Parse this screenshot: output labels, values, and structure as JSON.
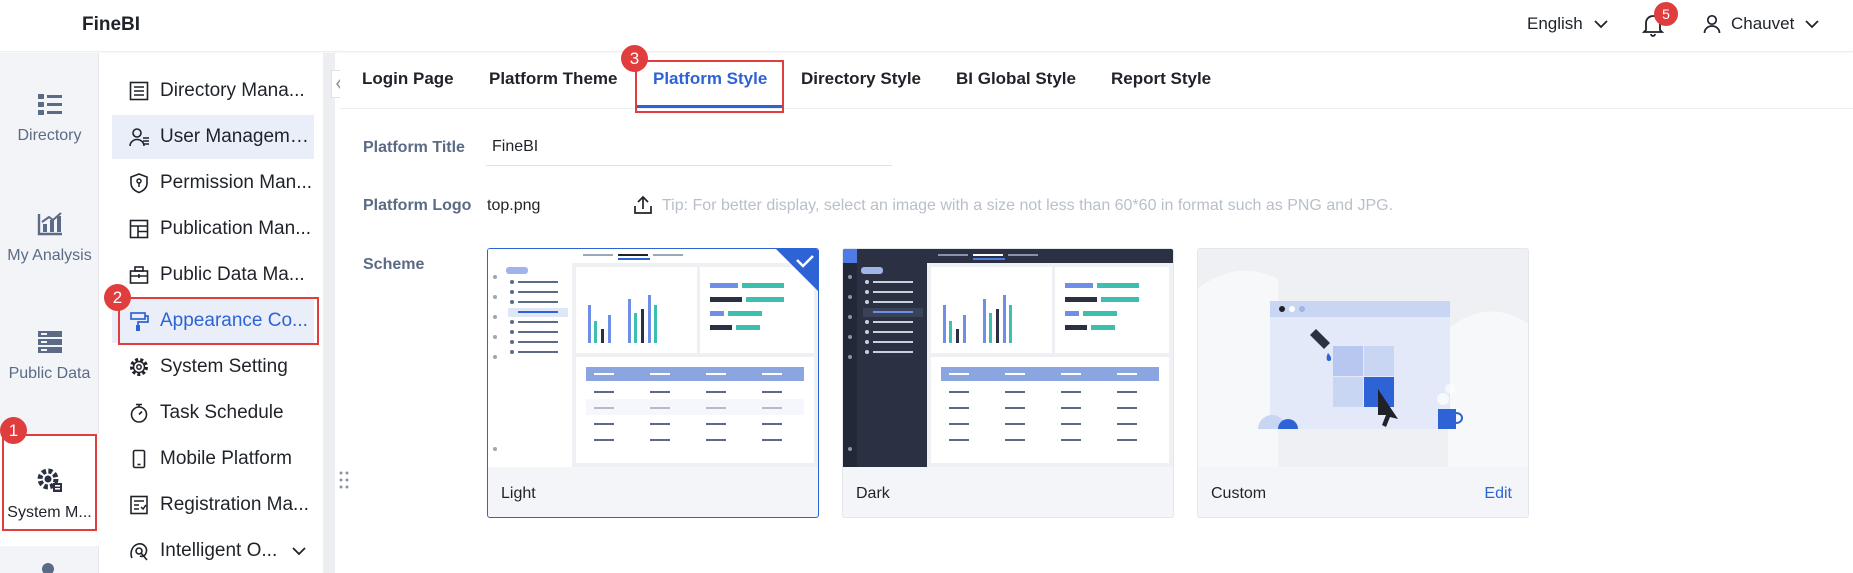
{
  "app": {
    "title": "FineBI"
  },
  "header": {
    "language": "English",
    "notification_count": "5",
    "username": "Chauvet"
  },
  "rail": {
    "items": [
      {
        "label": "Directory",
        "icon": "directory-icon"
      },
      {
        "label": "My Analysis",
        "icon": "analysis-icon"
      },
      {
        "label": "Public Data",
        "icon": "public-data-icon"
      },
      {
        "label": "System M...",
        "icon": "system-gear-icon"
      }
    ]
  },
  "submenu": {
    "items": [
      {
        "label": "Directory Mana...",
        "icon": "list-icon"
      },
      {
        "label": "User Management",
        "icon": "user-icon"
      },
      {
        "label": "Permission Man...",
        "icon": "shield-icon"
      },
      {
        "label": "Publication Man...",
        "icon": "layout-icon"
      },
      {
        "label": "Public Data Ma...",
        "icon": "briefcase-icon"
      },
      {
        "label": "Appearance Co...",
        "icon": "paint-roller-icon"
      },
      {
        "label": "System Setting",
        "icon": "gear-icon"
      },
      {
        "label": "Task Schedule",
        "icon": "stopwatch-icon"
      },
      {
        "label": "Mobile Platform",
        "icon": "mobile-icon"
      },
      {
        "label": "Registration Ma...",
        "icon": "document-icon"
      },
      {
        "label": "Intelligent O...",
        "icon": "intelligent-icon"
      }
    ]
  },
  "tabs": [
    {
      "label": "Login Page"
    },
    {
      "label": "Platform Theme"
    },
    {
      "label": "Platform Style"
    },
    {
      "label": "Directory Style"
    },
    {
      "label": "BI Global Style"
    },
    {
      "label": "Report Style"
    }
  ],
  "form": {
    "title_label": "Platform Title",
    "title_value": "FineBI",
    "logo_label": "Platform Logo",
    "logo_file": "top.png",
    "logo_tip": "Tip: For better display, select an image with a size not less than 60*60 in format such as PNG and JPG.",
    "scheme_label": "Scheme"
  },
  "schemes": [
    {
      "name": "Light"
    },
    {
      "name": "Dark"
    },
    {
      "name": "Custom",
      "action": "Edit"
    }
  ],
  "annotations": [
    "1",
    "2",
    "3"
  ],
  "colors": {
    "accent": "#2e63d6",
    "annotation": "#e03e3e",
    "dark_sidebar": "#2b3142",
    "teal": "#3cbfae"
  }
}
